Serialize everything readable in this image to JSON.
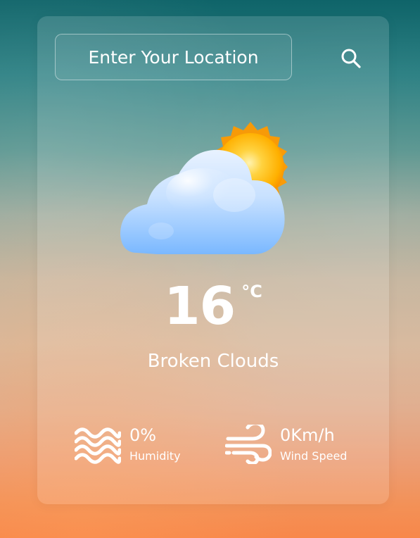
{
  "search": {
    "placeholder": "Enter Your Location",
    "button_icon": "search-icon"
  },
  "weather": {
    "icon": "partly-cloudy-icon",
    "temperature": "16",
    "unit": "°C",
    "condition": "Broken Clouds"
  },
  "metrics": {
    "humidity": {
      "value": "0%",
      "label": "Humidity",
      "icon": "waves-icon"
    },
    "wind": {
      "value": "0Km/h",
      "label": "Wind Speed",
      "icon": "wind-icon"
    }
  }
}
